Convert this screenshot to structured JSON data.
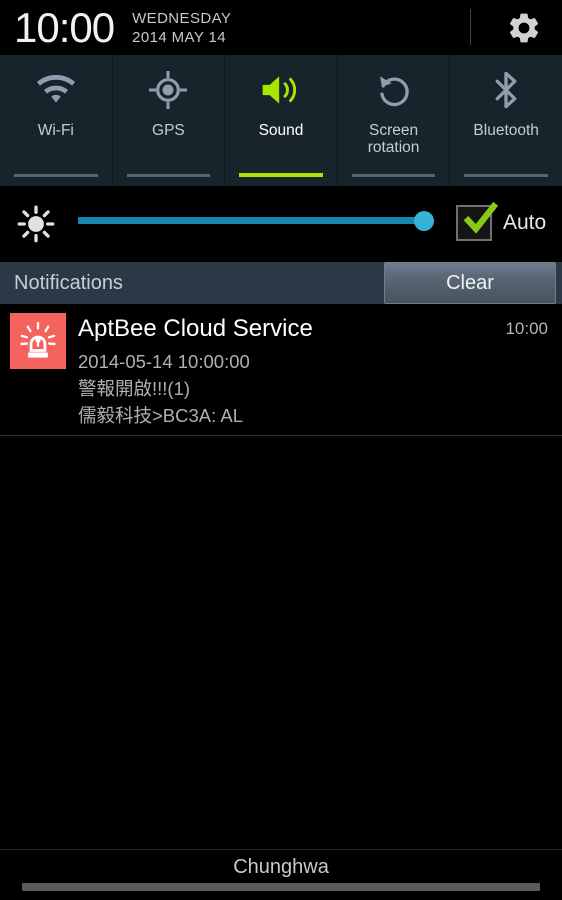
{
  "statusbar": {
    "time": "10:00",
    "day": "WEDNESDAY",
    "date": "2014 MAY 14",
    "settings_icon": "gear-icon"
  },
  "quick_toggles": [
    {
      "label": "Wi-Fi",
      "icon": "wifi-icon",
      "active": false
    },
    {
      "label": "GPS",
      "icon": "gps-icon",
      "active": false
    },
    {
      "label": "Sound",
      "icon": "sound-on-icon",
      "active": true
    },
    {
      "label": "Screen\nrotation",
      "label_line1": "Screen",
      "label_line2": "rotation",
      "icon": "screen-rotation-icon",
      "active": false
    },
    {
      "label": "Bluetooth",
      "icon": "bluetooth-icon",
      "active": false
    }
  ],
  "brightness": {
    "icon": "brightness-icon",
    "slider_value_percent": 97,
    "auto_label": "Auto",
    "auto_checked": true,
    "track_color": "#1787ae",
    "thumb_color": "#35b3d6",
    "check_color": "#8bc919"
  },
  "notifications_header": {
    "title": "Notifications",
    "clear_label": "Clear"
  },
  "notifications": [
    {
      "icon": "alarm-siren-icon",
      "icon_bg": "#f4635e",
      "title": "AptBee Cloud Service",
      "time": "10:00",
      "line1": "2014-05-14 10:00:00",
      "line2": "警報開啟!!!(1)",
      "line3": "儒毅科技>BC3A: AL"
    }
  ],
  "bottom": {
    "carrier": "Chunghwa",
    "handle": "drag-handle"
  },
  "colors": {
    "accent_green": "#a8e600",
    "panel_bg": "#18242c",
    "header_bg": "#2b3845"
  }
}
